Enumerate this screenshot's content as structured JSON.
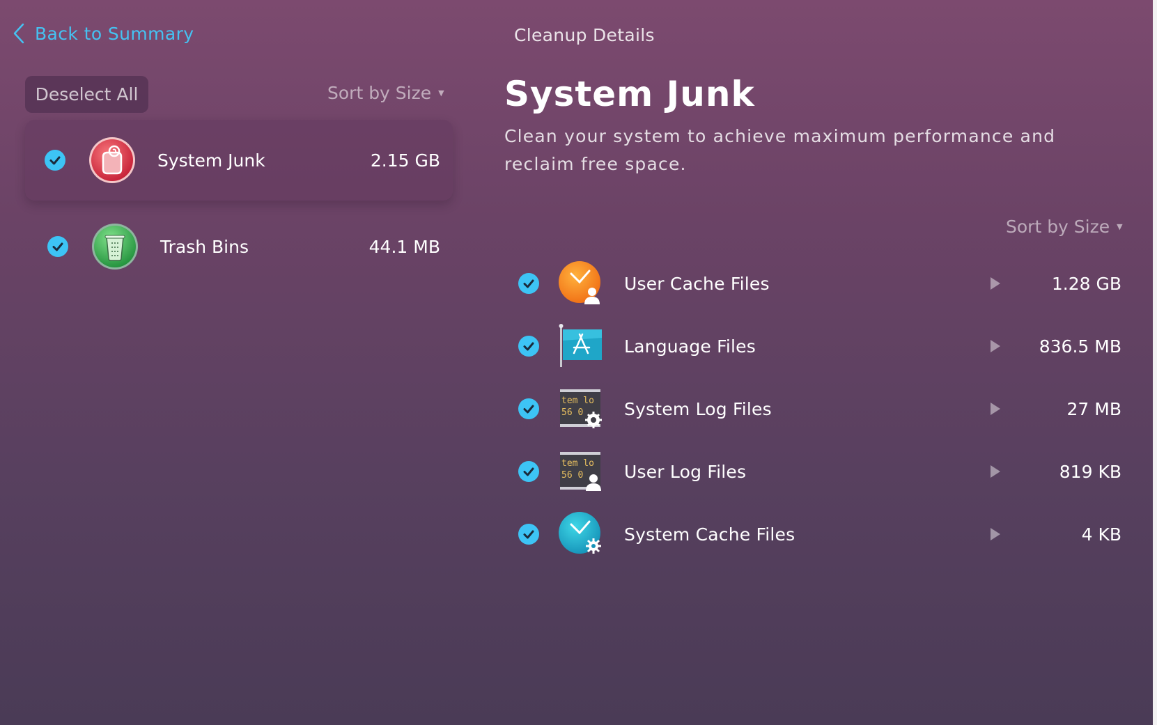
{
  "nav": {
    "back_label": "Back to Summary"
  },
  "left": {
    "deselect_label": "Deselect All",
    "sort_label": "Sort by Size",
    "categories": [
      {
        "label": "System Junk",
        "size": "2.15 GB",
        "checked": true,
        "selected": true,
        "icon": "system-junk-icon"
      },
      {
        "label": "Trash Bins",
        "size": "44.1 MB",
        "checked": true,
        "selected": false,
        "icon": "trash-bin-icon"
      }
    ]
  },
  "right": {
    "header": "Cleanup Details",
    "title": "System Junk",
    "description": "Clean your system to achieve maximum performance and reclaim free space.",
    "sort_label": "Sort by Size",
    "items": [
      {
        "label": "User Cache Files",
        "size": "1.28 GB",
        "checked": true,
        "icon": "user-cache-icon"
      },
      {
        "label": "Language Files",
        "size": "836.5 MB",
        "checked": true,
        "icon": "language-flag-icon"
      },
      {
        "label": "System Log Files",
        "size": "27 MB",
        "checked": true,
        "icon": "system-log-icon"
      },
      {
        "label": "User Log Files",
        "size": "819 KB",
        "checked": true,
        "icon": "user-log-icon"
      },
      {
        "label": "System Cache Files",
        "size": "4 KB",
        "checked": true,
        "icon": "system-cache-icon"
      }
    ],
    "log_icon_text": {
      "line1": "tem lo",
      "line2": "56 0"
    }
  },
  "colors": {
    "accent": "#3dc4f5",
    "back_link": "#45c2f2"
  }
}
